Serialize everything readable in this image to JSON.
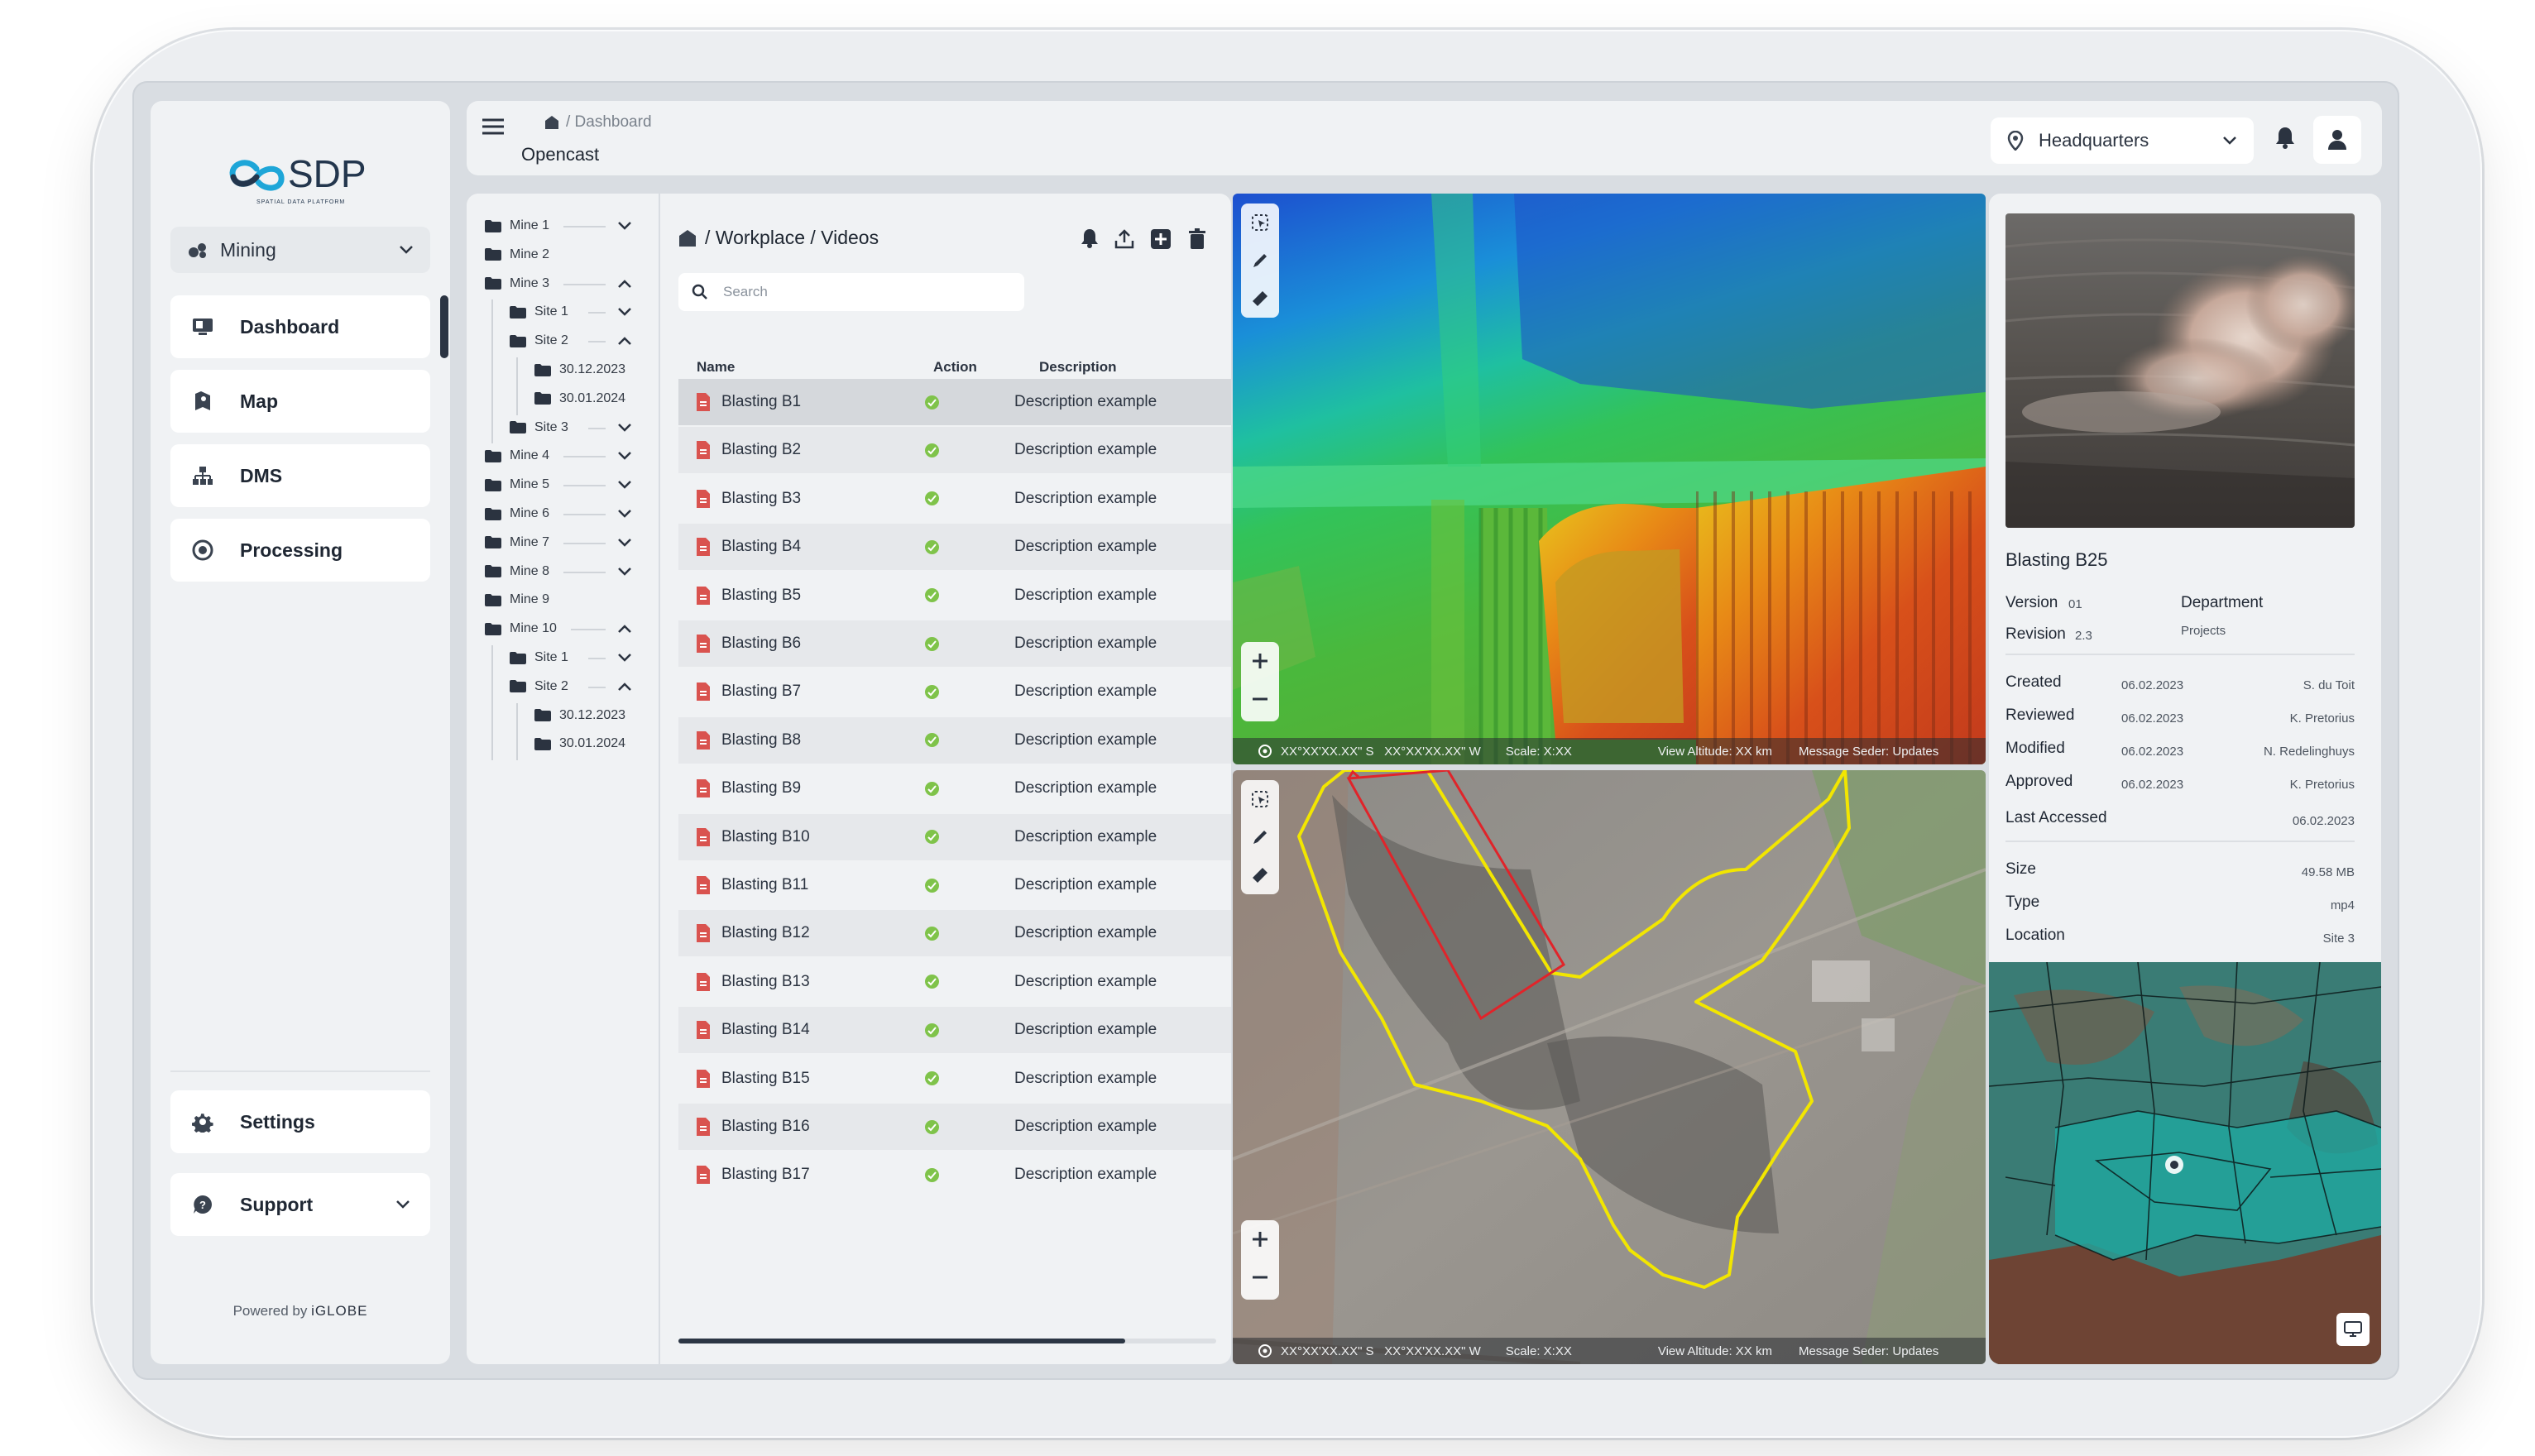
{
  "brand": {
    "name": "SDP",
    "tagline": "SPATIAL DATA PLATFORM",
    "powered_prefix": "Powered by",
    "powered_brand": "iGLOBE"
  },
  "nav": {
    "mode": "Mining",
    "items": [
      {
        "label": "Dashboard",
        "icon": "monitor-icon"
      },
      {
        "label": "Map",
        "icon": "map-icon"
      },
      {
        "label": "DMS",
        "icon": "sitemap-icon"
      },
      {
        "label": "Processing",
        "icon": "gear-circle-icon"
      }
    ],
    "settings": "Settings",
    "support": "Support"
  },
  "header": {
    "breadcrumb": "/ Dashboard",
    "title": "Opencast",
    "location": "Headquarters"
  },
  "tree": [
    {
      "label": "Mine 1",
      "level": 0,
      "chevron": "down"
    },
    {
      "label": "Mine 2",
      "level": 0,
      "chevron": ""
    },
    {
      "label": "Mine 3",
      "level": 0,
      "chevron": "up"
    },
    {
      "label": "Site 1",
      "level": 1,
      "chevron": "down"
    },
    {
      "label": "Site 2",
      "level": 1,
      "chevron": "up"
    },
    {
      "label": "30.12.2023",
      "level": 2,
      "chevron": ""
    },
    {
      "label": "30.01.2024",
      "level": 2,
      "chevron": ""
    },
    {
      "label": "Site 3",
      "level": 1,
      "chevron": "down"
    },
    {
      "label": "Mine 4",
      "level": 0,
      "chevron": "down"
    },
    {
      "label": "Mine 5",
      "level": 0,
      "chevron": "down"
    },
    {
      "label": "Mine 6",
      "level": 0,
      "chevron": "down"
    },
    {
      "label": "Mine 7",
      "level": 0,
      "chevron": "down"
    },
    {
      "label": "Mine 8",
      "level": 0,
      "chevron": "down"
    },
    {
      "label": "Mine 9",
      "level": 0,
      "chevron": ""
    },
    {
      "label": "Mine 10",
      "level": 0,
      "chevron": "up"
    },
    {
      "label": "Site 1",
      "level": 1,
      "chevron": "down"
    },
    {
      "label": "Site 2",
      "level": 1,
      "chevron": "up"
    },
    {
      "label": "30.12.2023",
      "level": 2,
      "chevron": ""
    },
    {
      "label": "30.01.2024",
      "level": 2,
      "chevron": ""
    }
  ],
  "files": {
    "path": "/ Workplace / Videos",
    "search_placeholder": "Search",
    "columns": {
      "name": "Name",
      "action": "Action",
      "description": "Description"
    },
    "rows": [
      {
        "name": "Blasting B1",
        "description": "Description example"
      },
      {
        "name": "Blasting B2",
        "description": "Description example"
      },
      {
        "name": "Blasting B3",
        "description": "Description example"
      },
      {
        "name": "Blasting B4",
        "description": "Description example"
      },
      {
        "name": "Blasting B5",
        "description": "Description example"
      },
      {
        "name": "Blasting B6",
        "description": "Description example"
      },
      {
        "name": "Blasting B7",
        "description": "Description example"
      },
      {
        "name": "Blasting B8",
        "description": "Description example"
      },
      {
        "name": "Blasting B9",
        "description": "Description example"
      },
      {
        "name": "Blasting B10",
        "description": "Description example"
      },
      {
        "name": "Blasting B11",
        "description": "Description example"
      },
      {
        "name": "Blasting B12",
        "description": "Description example"
      },
      {
        "name": "Blasting B13",
        "description": "Description example"
      },
      {
        "name": "Blasting B14",
        "description": "Description example"
      },
      {
        "name": "Blasting B15",
        "description": "Description example"
      },
      {
        "name": "Blasting B16",
        "description": "Description example"
      },
      {
        "name": "Blasting B17",
        "description": "Description example"
      }
    ],
    "scroll_fraction": 0.83
  },
  "maps": {
    "coords": "XX°XX'XX.XX\" S   XX°XX'XX.XX\" W",
    "scale": "Scale: X:XX",
    "altitude": "View Altitude: XX km",
    "message": "Message Seder: Updates"
  },
  "detail": {
    "title": "Blasting B25",
    "version_label": "Version",
    "version": "01",
    "revision_label": "Revision",
    "revision": "2.3",
    "department_label": "Department",
    "department": "Projects",
    "history": [
      {
        "label": "Created",
        "date": "06.02.2023",
        "person": "S. du Toit"
      },
      {
        "label": "Reviewed",
        "date": "06.02.2023",
        "person": "K. Pretorius"
      },
      {
        "label": "Modified",
        "date": "06.02.2023",
        "person": "N. Redelinghuys"
      },
      {
        "label": "Approved",
        "date": "06.02.2023",
        "person": "K. Pretorius"
      }
    ],
    "last_accessed_label": "Last Accessed",
    "last_accessed": "06.02.2023",
    "size_label": "Size",
    "size": "49.58 MB",
    "type_label": "Type",
    "type": "mp4",
    "location_label": "Location",
    "location": "Site 3"
  },
  "colors": {
    "accent": "#2c3644",
    "success": "#7fc34a",
    "file_icon": "#d9534f",
    "boundary_yellow": "#f2e600",
    "boundary_red": "#e0242a",
    "parcel_teal": "#1f9e98"
  }
}
